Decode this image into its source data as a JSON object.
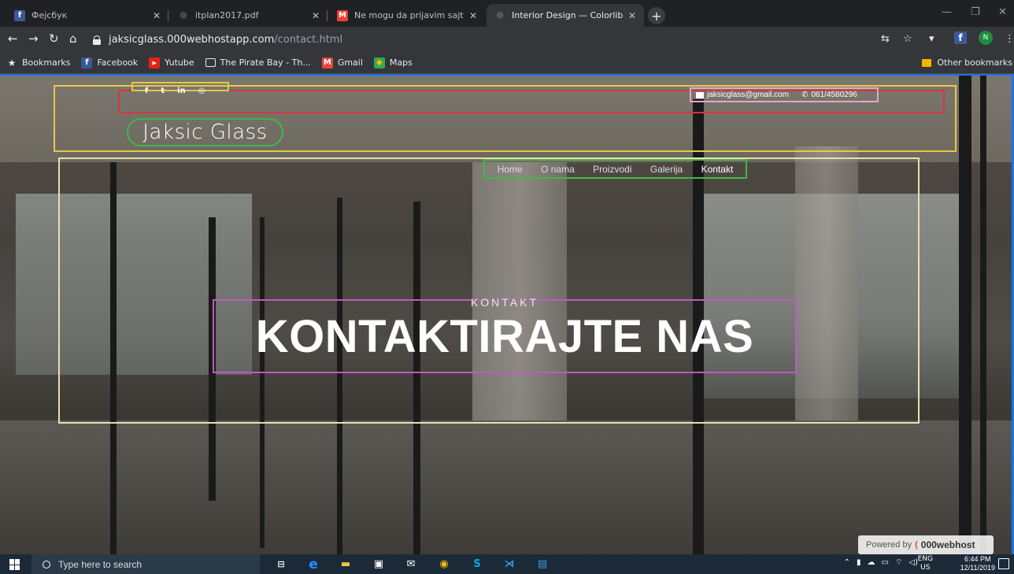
{
  "browser": {
    "tabs": [
      {
        "title": "Фејсбук",
        "favicon": "facebook-icon",
        "color": "#3b5998",
        "glyph": "f"
      },
      {
        "title": "itplan2017.pdf",
        "favicon": "globe-icon",
        "color": "#5f6368",
        "glyph": "◎"
      },
      {
        "title": "Ne mogu da prijavim sajt - nema",
        "favicon": "gmail-icon",
        "color": "#ea4335",
        "glyph": "M"
      },
      {
        "title": "Interior Design — Colorlib Websi",
        "favicon": "globe-icon",
        "color": "#5f6368",
        "glyph": "◎",
        "active": true
      }
    ],
    "url_host": "jaksicglass.000webhostapp.com",
    "url_path": "/contact.html",
    "profile_initial": "N",
    "bookmarks": [
      {
        "label": "Bookmarks",
        "icon": "star-icon"
      },
      {
        "label": "Facebook",
        "icon": "facebook-icon"
      },
      {
        "label": "Yutube",
        "icon": "youtube-icon"
      },
      {
        "label": "The Pirate Bay - Th...",
        "icon": "monitor-icon"
      },
      {
        "label": "Gmail",
        "icon": "gmail-icon"
      },
      {
        "label": "Maps",
        "icon": "maps-icon"
      }
    ],
    "other_bookmarks": "Other bookmarks"
  },
  "site": {
    "social_icons": [
      "f",
      "t",
      "in",
      "◎"
    ],
    "email": "jaksicglass@gmail.com",
    "phone": "061/4580296",
    "brand": "Jaksic Glass",
    "menu": [
      "Home",
      "O nama",
      "Proizvodi",
      "Galerija",
      "Kontakt"
    ],
    "menu_active": "Kontakt",
    "kicker": "KONTAKT",
    "headline": "KONTAKTIRAJTE NAS",
    "powered_by": "Powered by",
    "host_brand": "000webhost"
  },
  "taskbar": {
    "search_placeholder": "Type here to search",
    "lang_top": "ENG",
    "lang_bottom": "US",
    "time": "6:44 PM",
    "date": "12/11/2019"
  },
  "colors": {
    "annotation_yellow": "#e6c84a",
    "annotation_red": "#d8353b",
    "annotation_green": "#43b649",
    "annotation_purple": "#c05bc0",
    "annotation_pink": "#e7a6c9",
    "accent_blue": "#1a73e8"
  }
}
